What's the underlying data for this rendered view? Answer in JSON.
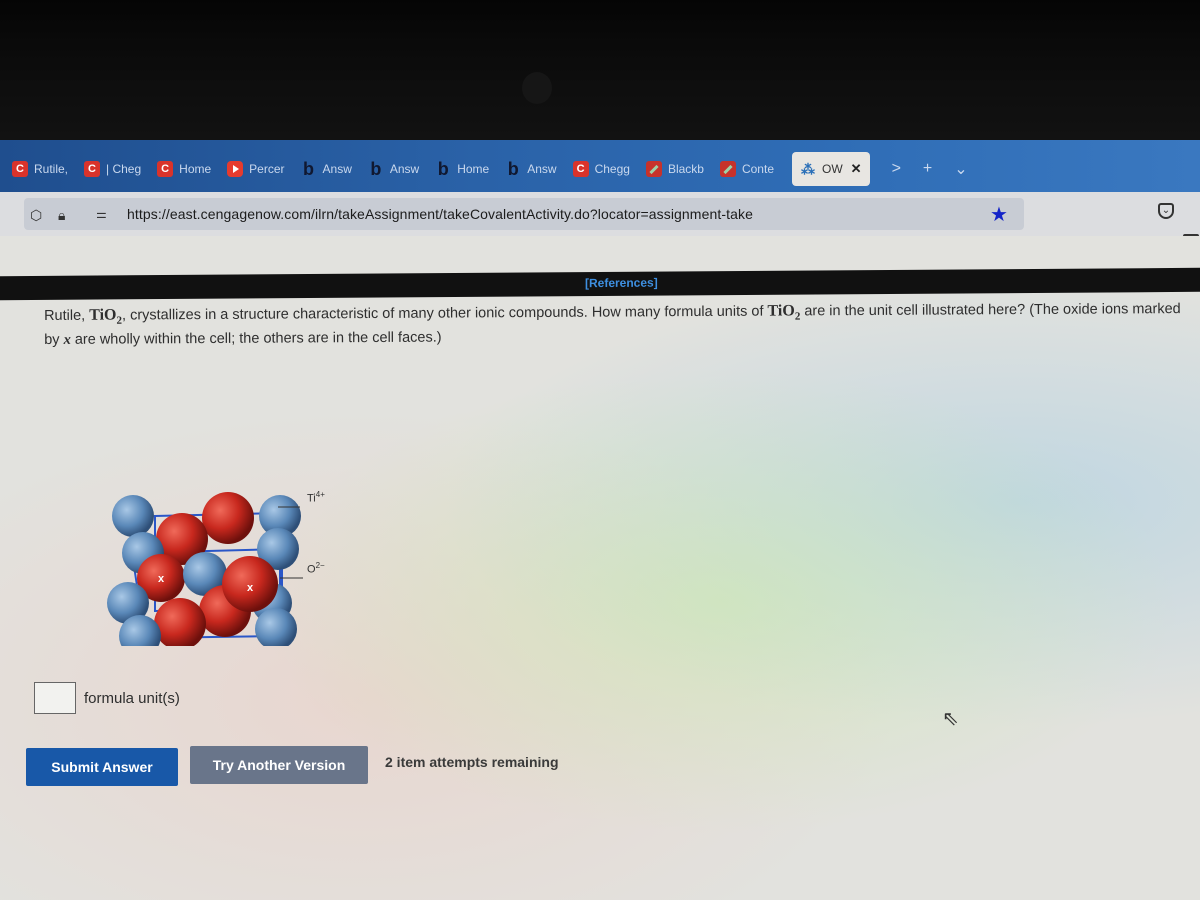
{
  "browser": {
    "tabs": [
      {
        "icon": "chegg-icon",
        "glyph": "C",
        "label": "Rutile,",
        "type": "chegg"
      },
      {
        "icon": "chegg-icon",
        "glyph": "C",
        "label": "| Cheg",
        "type": "chegg"
      },
      {
        "icon": "chegg-icon",
        "glyph": "C",
        "label": "Home",
        "type": "chegg"
      },
      {
        "icon": "youtube-icon",
        "glyph": "",
        "label": "Percer",
        "type": "yt"
      },
      {
        "icon": "bartleby-icon",
        "glyph": "b",
        "label": "Answ",
        "type": "bartleby"
      },
      {
        "icon": "bartleby-icon",
        "glyph": "b",
        "label": "Answ",
        "type": "bartleby"
      },
      {
        "icon": "bartleby-icon",
        "glyph": "b",
        "label": "Home",
        "type": "bartleby"
      },
      {
        "icon": "bartleby-icon",
        "glyph": "b",
        "label": "Answ",
        "type": "bartleby"
      },
      {
        "icon": "chegg-icon",
        "glyph": "C",
        "label": "Chegg",
        "type": "chegg"
      },
      {
        "icon": "blackboard-icon",
        "glyph": "",
        "label": "Blackb",
        "type": "bb"
      },
      {
        "icon": "blackboard-icon",
        "glyph": "",
        "label": "Conte",
        "type": "bb"
      }
    ],
    "active_tab": {
      "icon": "owl-icon",
      "glyph": "⁂",
      "label": "OW",
      "close": "✕"
    },
    "tab_controls": {
      "scroll": ">",
      "new_tab": "+",
      "list": "⌄"
    },
    "url": "https://east.cengagenow.com/ilrn/takeAssignment/takeCovalentActivity.do?locator=assignment-take",
    "bookmark_star": "★"
  },
  "page": {
    "references_label": "[References]",
    "question": {
      "part1": "Rutile, ",
      "formula_base": "TiO",
      "formula_sub": "2",
      "part2": ", crystallizes in a structure characteristic of many other ionic compounds. How many formula units of ",
      "part3": " are in the unit cell illustrated here? (The oxide ions marked by ",
      "marker": "x",
      "part4": " are wholly within the cell; the others are in the cell faces.)"
    },
    "figure": {
      "ti_label": "Ti",
      "ti_charge": "4+",
      "o_label": "O",
      "o_charge": "2−",
      "marker": "x",
      "colors": {
        "ti": "#5a88b8",
        "o": "#c8281e",
        "cell_edge": "#2a56c8"
      }
    },
    "answer": {
      "value": "",
      "unit": "formula unit(s)"
    },
    "buttons": {
      "submit": "Submit Answer",
      "try_another": "Try Another Version"
    },
    "attempts_text": "2 item attempts remaining"
  }
}
